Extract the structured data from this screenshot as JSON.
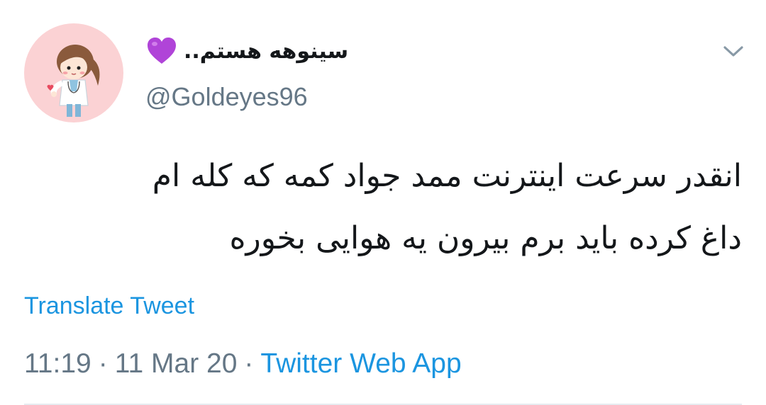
{
  "user": {
    "display_name": "سینوهه هستم..",
    "name_emoji": "purple-heart-icon",
    "handle": "@Goldeyes96"
  },
  "tweet": {
    "lines": [
      "انقدر سرعت اینترنت ممد جواد کمه که کله ام",
      "داغ کرده باید برم بیرون یه هوایی بخوره"
    ],
    "translate_label": "Translate Tweet"
  },
  "meta": {
    "time": "11:19",
    "separator": "·",
    "date": "11 Mar 20",
    "source": "Twitter Web App"
  },
  "colors": {
    "link": "#1b95e0",
    "secondary_text": "#657786",
    "primary_text": "#14171a",
    "avatar_bg": "#fbd2d4",
    "heart": "#b044d8"
  }
}
